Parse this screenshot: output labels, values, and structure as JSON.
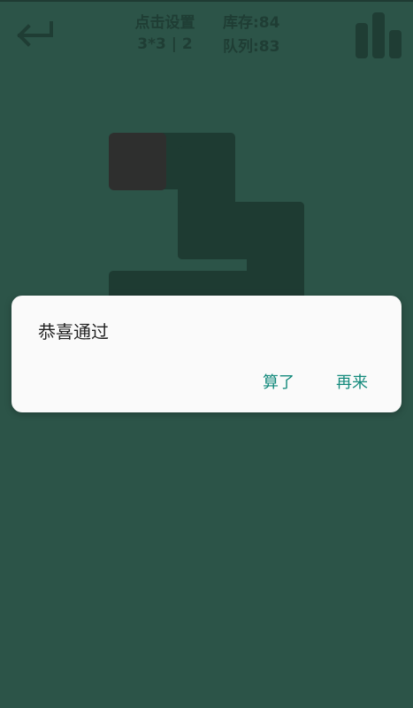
{
  "header": {
    "back_icon": "return-arrow-icon",
    "settings_title": "点击设置",
    "level_info": "3*3 | 2",
    "stock": "库存:84",
    "queue": "队列:83",
    "stats_icon": "bar-chart-icon"
  },
  "colors": {
    "background": "#2c5448",
    "tile": "#1e3b32",
    "active_tile": "#2e2f2e",
    "dialog_background": "#fafafa",
    "accent": "#148a7c"
  },
  "dialog": {
    "message": "恭喜通过",
    "cancel_label": "算了",
    "retry_label": "再来"
  }
}
